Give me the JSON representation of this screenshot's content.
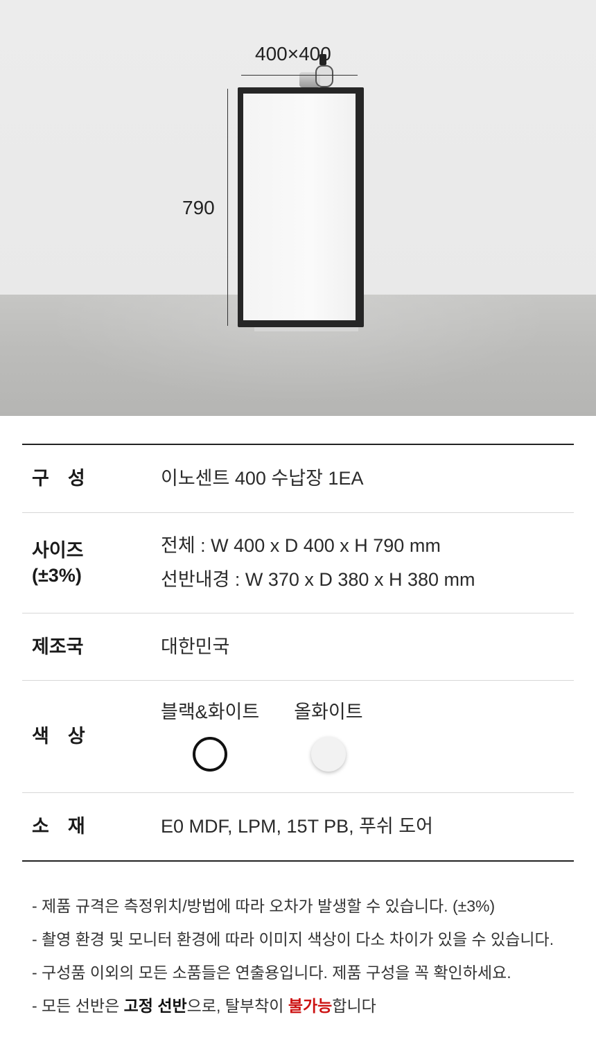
{
  "dimensions": {
    "top": "400×400",
    "side": "790"
  },
  "spec": {
    "rows": [
      {
        "label": "구　성",
        "value": "이노센트 400 수납장 1EA"
      },
      {
        "label_line1": "사이즈",
        "label_line2": "(±3%)",
        "value_line1": "전체 : W 400 x D 400 x H 790 mm",
        "value_line2": "선반내경 : W 370 x D 380 x H 380 mm"
      },
      {
        "label": "제조국",
        "value": "대한민국"
      },
      {
        "label": "색　상",
        "colors": [
          {
            "name": "블랙&화이트",
            "swatch": "#111111"
          },
          {
            "name": "올화이트",
            "swatch": "#f2f2f2"
          }
        ]
      },
      {
        "label": "소　재",
        "value": "E0 MDF, LPM, 15T PB, 푸쉬 도어"
      }
    ]
  },
  "notes": {
    "n1": "- 제품 규격은 측정위치/방법에 따라 오차가 발생할 수 있습니다. (±3%)",
    "n2": "- 촬영 환경 및 모니터 환경에 따라 이미지 색상이 다소 차이가 있을 수 있습니다.",
    "n3": "- 구성품 이외의 모든 소품들은 연출용입니다. 제품 구성을 꼭 확인하세요.",
    "n4_prefix": "- 모든 선반은 ",
    "n4_bold": "고정 선반",
    "n4_mid": "으로, 탈부착이 ",
    "n4_warn": "불가능",
    "n4_suffix": "합니다"
  },
  "colors": {
    "warn": "#cc1111",
    "frame": "#262626"
  }
}
